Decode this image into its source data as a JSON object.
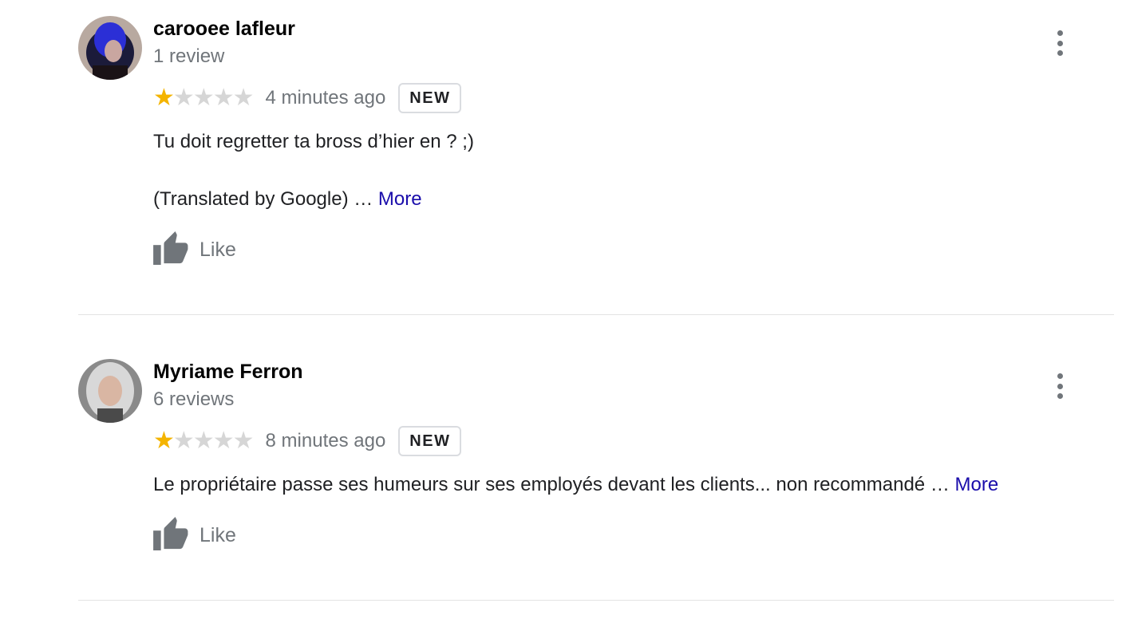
{
  "reviews": [
    {
      "author": "carooee lafleur",
      "review_count": "1 review",
      "rating": 1,
      "rating_max": 5,
      "time": "4 minutes ago",
      "badge": "NEW",
      "text_line1": "Tu doit regretter ta bross d’hier en ? ;)",
      "text_line2": "(Translated by Google) …",
      "more_label": "More",
      "like_label": "Like",
      "icons": {
        "menu": "more-vert-icon",
        "like": "thumb-up-icon",
        "star": "star-icon"
      },
      "colors": {
        "star_filled": "#f4b400",
        "star_empty": "#d6d6d6",
        "link": "#1a0dab"
      }
    },
    {
      "author": "Myriame Ferron",
      "review_count": "6 reviews",
      "rating": 1,
      "rating_max": 5,
      "time": "8 minutes ago",
      "badge": "NEW",
      "text_line1": "Le propriétaire passe ses humeurs sur ses employés devant les clients... non recommandé …",
      "more_label": "More",
      "like_label": "Like",
      "icons": {
        "menu": "more-vert-icon",
        "like": "thumb-up-icon",
        "star": "star-icon"
      },
      "colors": {
        "star_filled": "#f4b400",
        "star_empty": "#d6d6d6",
        "link": "#1a0dab"
      }
    }
  ]
}
